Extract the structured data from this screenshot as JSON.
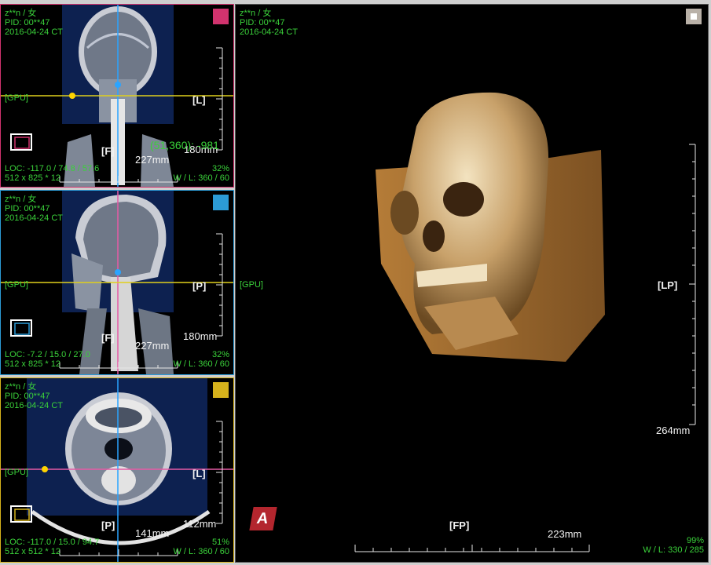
{
  "patient": {
    "name": "z**n / 女",
    "pid": "PID: 00**47",
    "study": "2016-04-24 CT"
  },
  "gpu_label": "[GPU]",
  "views": {
    "coronal": {
      "orient_right": "[L]",
      "orient_bottom": "[F]",
      "scale_label": "180mm",
      "width_label": "227mm",
      "probe": "(51,360): -981",
      "loc": "LOC: -117.0 / 74.8 / 57.6",
      "dims": "512 x 825 * 12",
      "zoom": "32%",
      "wl": "W / L:  360 / 60",
      "color": "#d1336e"
    },
    "sagittal": {
      "orient_right": "[P]",
      "orient_bottom": "[F]",
      "scale_label": "180mm",
      "width_label": "227mm",
      "loc": "LOC: -7.2 / 15.0 / 27.0",
      "dims": "512 x 825 * 12",
      "zoom": "32%",
      "wl": "W / L:  360 / 60",
      "color": "#2c9bd6"
    },
    "axial": {
      "orient_right": "[L]",
      "orient_bottom": "[P]",
      "scale_label": "112mm",
      "width_label": "141mm",
      "loc": "LOC: -117.0 / 15.0 / 94.7",
      "dims": "512 x 512 * 12",
      "zoom": "51%",
      "wl": "W / L:  360 / 60",
      "color": "#d6b21c"
    },
    "volume": {
      "orient_right": "[LP]",
      "orient_bottom": "[FP]",
      "scale_label": "264mm",
      "width_label": "223mm",
      "zoom": "99%",
      "wl": "W / L:  330 / 285",
      "corner_icon": "square-icon",
      "logo_text": "A"
    }
  }
}
